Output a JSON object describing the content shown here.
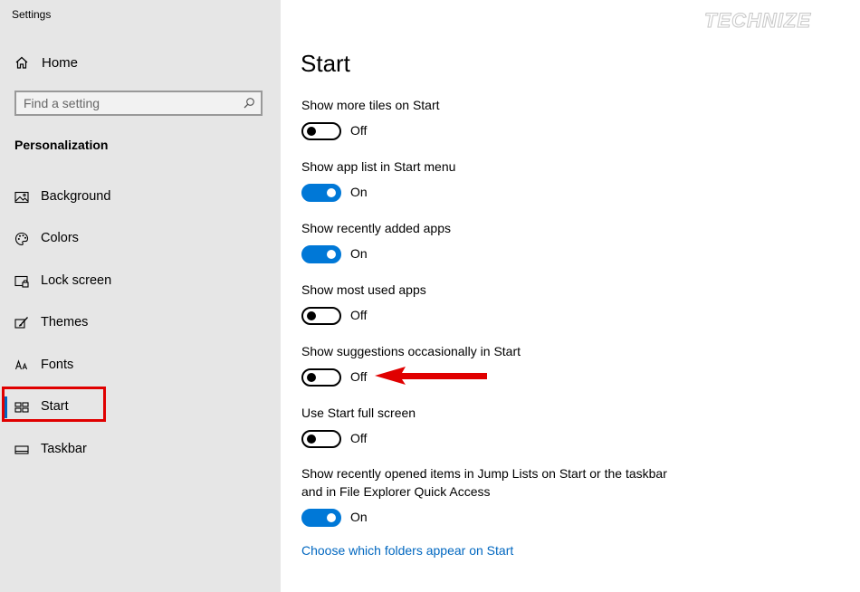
{
  "window": {
    "title": "Settings",
    "watermark": "TECHNIZE"
  },
  "sidebar": {
    "home_label": "Home",
    "search_placeholder": "Find a setting",
    "section_title": "Personalization",
    "items": [
      {
        "label": "Background",
        "icon": "background-icon"
      },
      {
        "label": "Colors",
        "icon": "palette-icon"
      },
      {
        "label": "Lock screen",
        "icon": "lock-screen-icon"
      },
      {
        "label": "Themes",
        "icon": "brush-icon"
      },
      {
        "label": "Fonts",
        "icon": "fonts-icon"
      },
      {
        "label": "Start",
        "icon": "start-icon",
        "selected": true
      },
      {
        "label": "Taskbar",
        "icon": "taskbar-icon"
      }
    ]
  },
  "main": {
    "title": "Start",
    "settings": [
      {
        "label": "Show more tiles on Start",
        "state": "Off",
        "on": false
      },
      {
        "label": "Show app list in Start menu",
        "state": "On",
        "on": true
      },
      {
        "label": "Show recently added apps",
        "state": "On",
        "on": true
      },
      {
        "label": "Show most used apps",
        "state": "Off",
        "on": false
      },
      {
        "label": "Show suggestions occasionally in Start",
        "state": "Off",
        "on": false
      },
      {
        "label": "Use Start full screen",
        "state": "Off",
        "on": false
      },
      {
        "label": "Show recently opened items in Jump Lists on Start or the taskbar and in File Explorer Quick Access",
        "state": "On",
        "on": true
      }
    ],
    "link": "Choose which folders appear on Start"
  },
  "colors": {
    "accent": "#0078d7",
    "link": "#0067c0",
    "annotation": "#e00000"
  }
}
